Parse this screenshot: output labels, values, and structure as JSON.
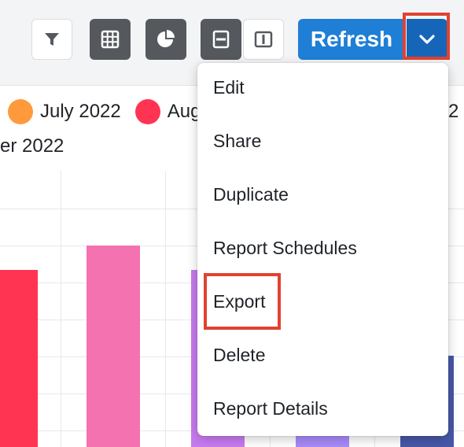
{
  "toolbar": {
    "buttons": [
      {
        "name": "filter-button",
        "icon": "filter-icon"
      },
      {
        "name": "table-view-button",
        "icon": "grid-icon"
      },
      {
        "name": "chart-view-button",
        "icon": "pie-chart-icon"
      },
      {
        "name": "rows-layout-button",
        "icon": "rows-layout-icon"
      },
      {
        "name": "columns-layout-button",
        "icon": "columns-layout-icon"
      }
    ],
    "refresh_label": "Refresh",
    "dropdown_icon": "chevron-down-icon",
    "accent": "#1f7fd6",
    "highlight_color": "#e1422f"
  },
  "legend": {
    "items": [
      {
        "label": "July 2022",
        "color": "#ff9a3c"
      },
      {
        "label": "Aug",
        "color": "#ff3352"
      },
      {
        "label": "2",
        "color": ""
      }
    ],
    "row2_text": "er 2022"
  },
  "chart_bars": [
    {
      "color": "#ff3352",
      "value": 0.64
    },
    {
      "color": "#f472b0",
      "value": 0.73
    },
    {
      "color": "#c77bf0",
      "value": 0.64
    },
    {
      "color": "#a78bfa",
      "value": 0.21
    },
    {
      "color": "#4858a8",
      "value": 0.33
    }
  ],
  "menu": {
    "items": [
      "Edit",
      "Share",
      "Duplicate",
      "Report Schedules",
      "Export",
      "Delete",
      "Report Details"
    ]
  }
}
